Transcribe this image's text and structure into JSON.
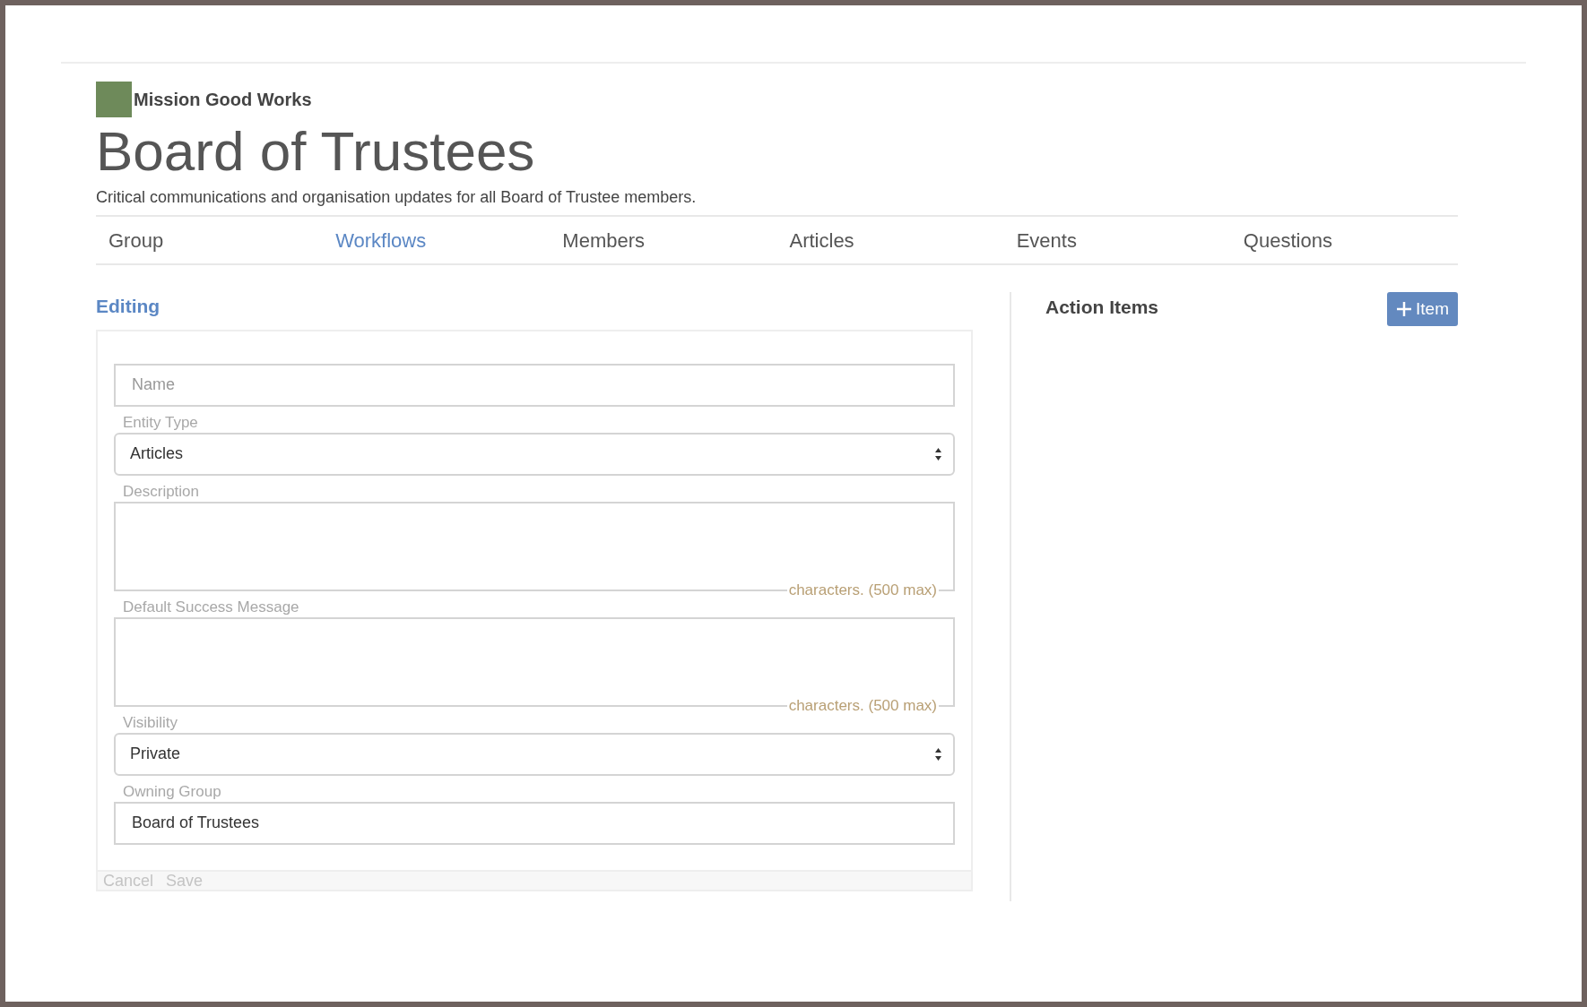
{
  "org": {
    "name": "Mission Good Works"
  },
  "group": {
    "title": "Board of Trustees",
    "description": "Critical communications and organisation updates for all Board of Trustee members."
  },
  "tabs": [
    {
      "label": "Group",
      "selected": false
    },
    {
      "label": "Workflows",
      "selected": true
    },
    {
      "label": "Members",
      "selected": false
    },
    {
      "label": "Articles",
      "selected": false
    },
    {
      "label": "Events",
      "selected": false
    },
    {
      "label": "Questions",
      "selected": false
    }
  ],
  "editor": {
    "heading": "Editing",
    "fields": [
      {
        "kind": "input",
        "placeholder": "Name"
      },
      {
        "kind": "select",
        "label": "Entity Type",
        "value": "Articles"
      },
      {
        "kind": "textarea",
        "label": "Description",
        "counter": "characters. (500 max)"
      },
      {
        "kind": "textarea",
        "label": "Default Success Message",
        "counter": "characters. (500 max)"
      },
      {
        "kind": "select",
        "label": "Visibility",
        "value": "Private"
      },
      {
        "kind": "input",
        "label": "Owning Group",
        "value": "Board of Trustees"
      }
    ],
    "actions": [
      {
        "label": "Cancel",
        "disabled": true
      },
      {
        "label": "Save",
        "disabled": true
      }
    ]
  },
  "action_items": {
    "heading": "Action Items",
    "add_button": "Item"
  }
}
